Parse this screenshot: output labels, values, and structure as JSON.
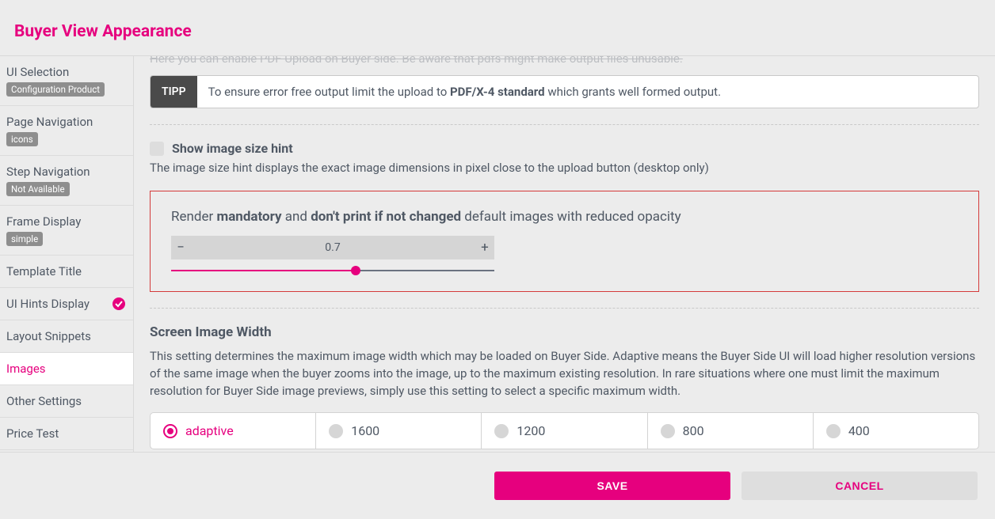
{
  "page_title": "Buyer View Appearance",
  "sidebar": {
    "items": [
      {
        "label": "UI Selection",
        "badge": "Configuration Product"
      },
      {
        "label": "Page Navigation",
        "badge": "icons"
      },
      {
        "label": "Step Navigation",
        "badge": "Not Available"
      },
      {
        "label": "Frame Display",
        "badge": "simple"
      },
      {
        "label": "Template Title"
      },
      {
        "label": "UI Hints Display",
        "check": true
      },
      {
        "label": "Layout Snippets"
      },
      {
        "label": "Images",
        "active": true
      },
      {
        "label": "Other Settings"
      },
      {
        "label": "Price Test"
      }
    ]
  },
  "cutoff_line": "Here you can enable PDF Upload on Buyer side. Be aware that pdfs might make output files unusable.",
  "tipp": {
    "label": "TIPP",
    "text_before": "To ensure error free output limit the upload to ",
    "text_bold": "PDF/X-4 standard",
    "text_after": " which grants well formed output."
  },
  "show_hint": {
    "label": "Show image size hint",
    "help": "The image size hint displays the exact image dimensions in pixel close to the upload button (desktop only)"
  },
  "opacity_box": {
    "pre": "Render ",
    "b1": "mandatory",
    "mid": " and ",
    "b2": "don't print if not changed",
    "post": " default images with reduced opacity",
    "value": "0.7",
    "minus": "−",
    "plus": "+",
    "slider_pct": 57
  },
  "screen_width": {
    "heading": "Screen Image Width",
    "help": "This setting determines the maximum image width which may be loaded on Buyer Side. Adaptive means the Buyer Side UI will load higher resolution versions of the same image when the buyer zooms into the image, up to the maximum existing resolution. In rare situations where one must limit the maximum resolution for Buyer Side image previews, simply use this setting to select a specific maximum width.",
    "options": [
      "adaptive",
      "1600",
      "1200",
      "800",
      "400"
    ],
    "selected": "adaptive"
  },
  "footer": {
    "save": "SAVE",
    "cancel": "CANCEL"
  }
}
